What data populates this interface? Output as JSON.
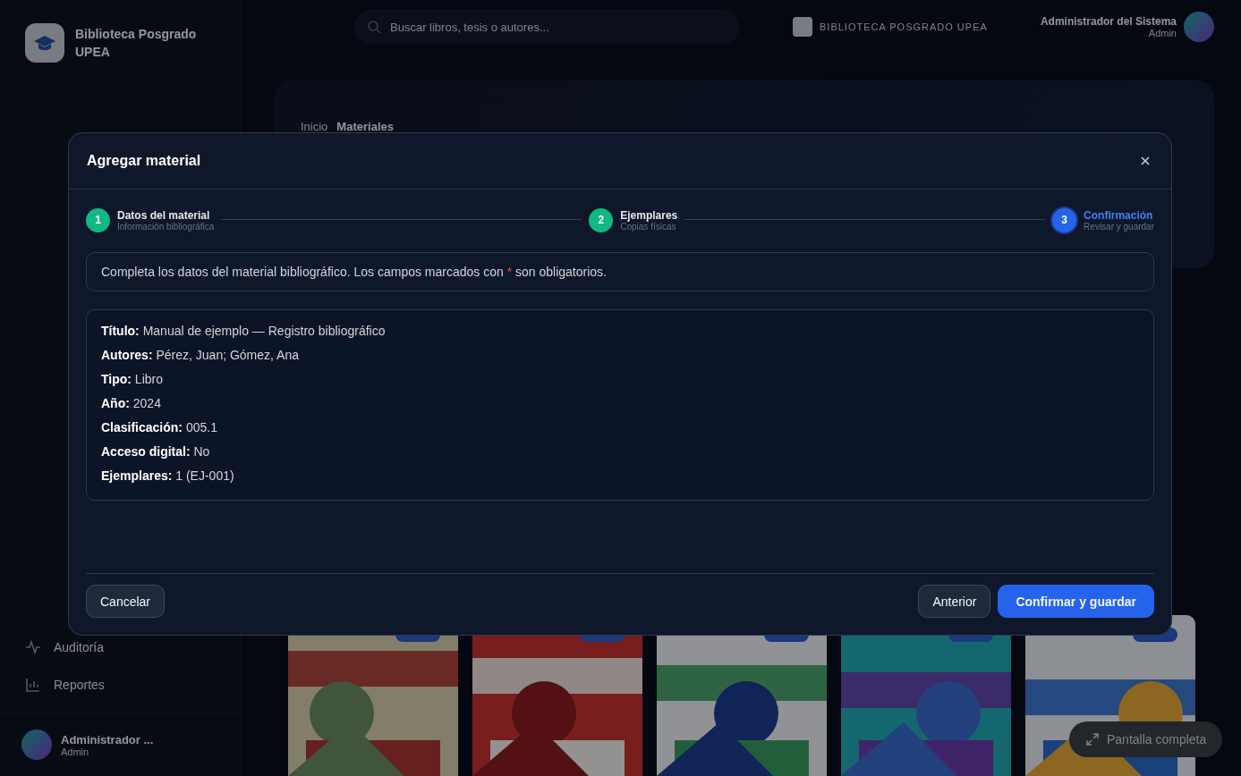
{
  "app": {
    "name": "Biblioteca Posgrado UPEA",
    "search": {
      "placeholder": "Buscar libros, tesis o autores..."
    },
    "brand": "BIBLIOTECA POSGRADO UPEA",
    "user": {
      "name": "Administrador del Sistema",
      "role": "Admin"
    },
    "sidebar": {
      "items": [
        {
          "label": "Auditoría",
          "kind": "pulse"
        },
        {
          "label": "Reportes",
          "kind": "chart"
        }
      ],
      "footer": {
        "name": "Administrador ...",
        "role": "Admin"
      }
    },
    "breadcrumb": [
      "Inicio",
      "Materiales"
    ],
    "gallery": [
      {
        "kind": "picture"
      },
      {
        "kind": "picture"
      },
      {
        "kind": "picture"
      },
      {
        "kind": "picture"
      },
      {
        "kind": "picture"
      }
    ],
    "fullscreen_button": "Pantalla completa"
  },
  "modal": {
    "title": "Agregar material",
    "steps": [
      {
        "number": "1",
        "title": "Datos del material",
        "subtitle": "Información bibliográfica",
        "completed": true,
        "selected": false
      },
      {
        "number": "2",
        "title": "Ejemplares",
        "subtitle": "Copias físicas",
        "completed": true,
        "selected": false
      },
      {
        "number": "3",
        "title": "Confirmación",
        "subtitle": "Revisar y guardar",
        "completed": false,
        "selected": true
      }
    ],
    "hint": {
      "before": "Completa los datos del material bibliográfico. Los campos marcados con",
      "mark": "*",
      "after": "son obligatorios."
    },
    "summary": [
      {
        "label": "Título:",
        "value": "Manual de ejemplo — Registro bibliográfico"
      },
      {
        "label": "Autores:",
        "value": "Pérez, Juan; Gómez, Ana"
      },
      {
        "label": "Tipo:",
        "value": "Libro"
      },
      {
        "label": "Año:",
        "value": "2024"
      },
      {
        "label": "Clasificación:",
        "value": "005.1"
      },
      {
        "label": "Acceso digital:",
        "value": "No"
      },
      {
        "label": "Ejemplares:",
        "value": "1 (EJ-001)"
      }
    ],
    "buttons": {
      "cancel": "Cancelar",
      "back": "Anterior",
      "confirm": "Confirmar y guardar"
    }
  }
}
